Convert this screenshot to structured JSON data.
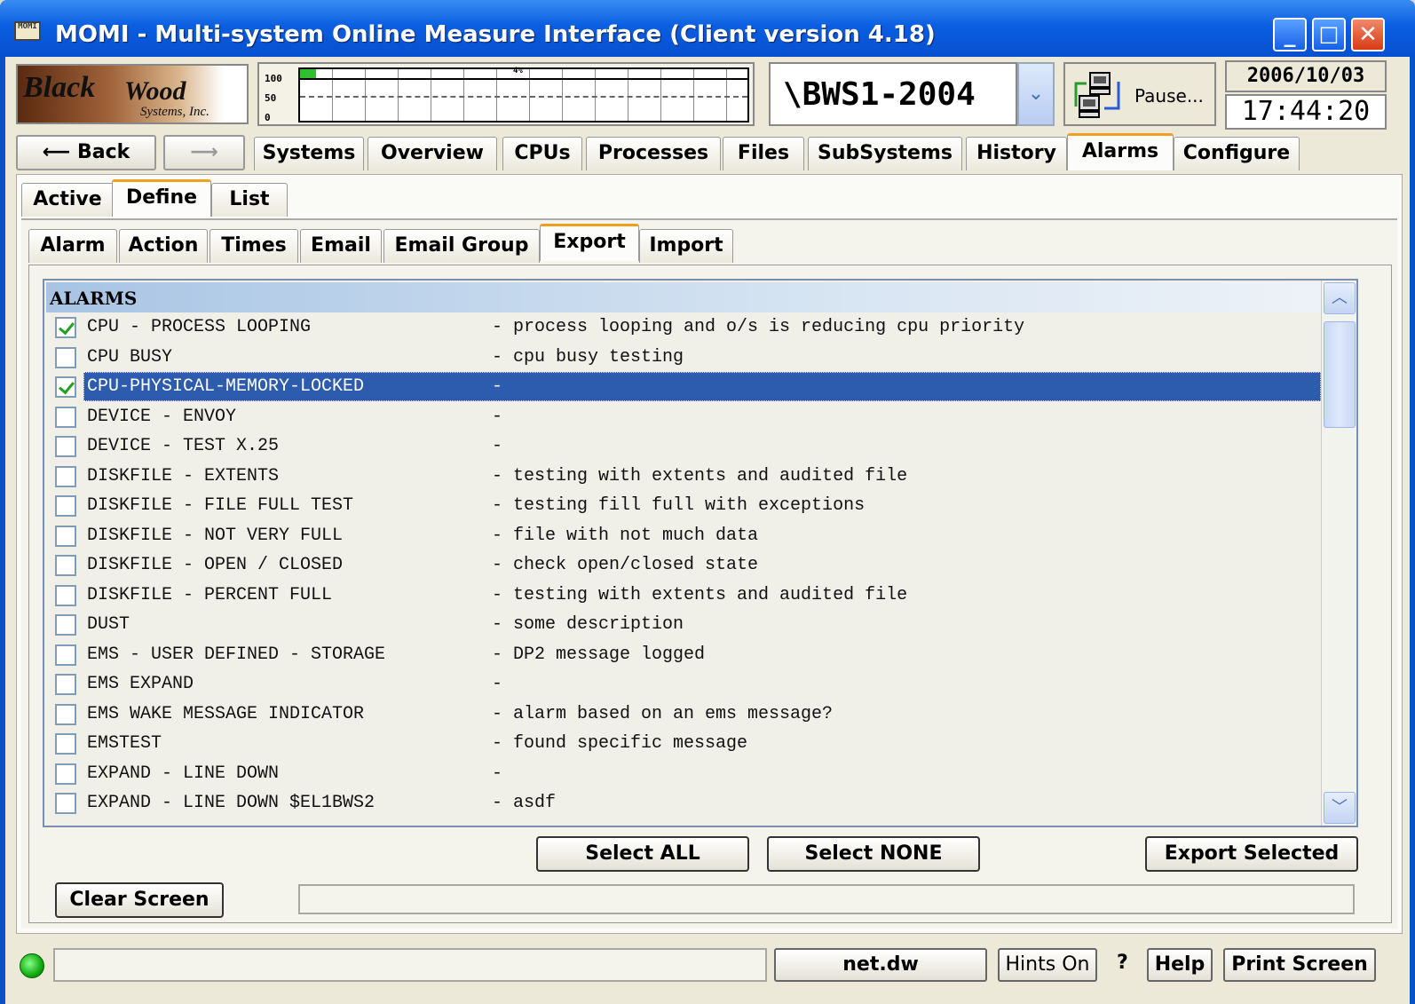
{
  "window": {
    "title": "MOMI - Multi-system Online Measure Interface (Client version 4.18)",
    "icon_text": "MOMI"
  },
  "logo": {
    "line1": "Black",
    "line2": "Wood",
    "line3": "Systems, Inc."
  },
  "cpu_graph": {
    "y_labels": [
      "100",
      "50",
      "0"
    ],
    "pct_label": "4%",
    "bar_color": "#2ec02e"
  },
  "system": {
    "name": "\\BWS1-2004",
    "dropdown_icon": "chevron-down-icon"
  },
  "pause": {
    "label": "Pause..."
  },
  "clock": {
    "date": "2006/10/03",
    "time": "17:44:20"
  },
  "nav": {
    "back": "Back",
    "forward": ""
  },
  "main_tabs": [
    "Systems",
    "Overview",
    "CPUs",
    "Processes",
    "Files",
    "SubSystems",
    "History",
    "Alarms",
    "Configure"
  ],
  "main_tab_selected": "Alarms",
  "sub_tabs": [
    "Active",
    "Define",
    "List"
  ],
  "sub_tab_selected": "Define",
  "define_tabs": [
    "Alarm",
    "Action",
    "Times",
    "Email",
    "Email Group",
    "Export",
    "Import"
  ],
  "define_tab_selected": "Export",
  "alarms_list": {
    "header": "ALARMS",
    "rows": [
      {
        "name": "CPU - PROCESS LOOPING",
        "desc": "- process looping and o/s is reducing cpu priority",
        "checked": true
      },
      {
        "name": "CPU BUSY",
        "desc": "- cpu busy testing",
        "checked": false
      },
      {
        "name": "CPU-PHYSICAL-MEMORY-LOCKED",
        "desc": "-",
        "checked": true,
        "selected": true
      },
      {
        "name": "DEVICE - ENVOY",
        "desc": "-",
        "checked": false
      },
      {
        "name": "DEVICE - TEST X.25",
        "desc": "-",
        "checked": false
      },
      {
        "name": "DISKFILE - EXTENTS",
        "desc": "- testing with extents and audited file",
        "checked": false
      },
      {
        "name": "DISKFILE - FILE FULL TEST",
        "desc": "- testing fill full with exceptions",
        "checked": false
      },
      {
        "name": "DISKFILE - NOT VERY FULL",
        "desc": "- file with not much data",
        "checked": false
      },
      {
        "name": "DISKFILE - OPEN / CLOSED",
        "desc": "- check open/closed state",
        "checked": false
      },
      {
        "name": "DISKFILE - PERCENT FULL",
        "desc": "- testing with extents and audited file",
        "checked": false
      },
      {
        "name": "DUST",
        "desc": "- some description",
        "checked": false
      },
      {
        "name": "EMS - USER DEFINED - STORAGE",
        "desc": "- DP2 message logged",
        "checked": false
      },
      {
        "name": "EMS EXPAND",
        "desc": "-",
        "checked": false
      },
      {
        "name": "EMS WAKE MESSAGE INDICATOR",
        "desc": "- alarm based on an ems message?",
        "checked": false
      },
      {
        "name": "EMSTEST",
        "desc": "- found specific message",
        "checked": false
      },
      {
        "name": "EXPAND - LINE DOWN",
        "desc": "-",
        "checked": false
      },
      {
        "name": "EXPAND - LINE DOWN $EL1BWS2",
        "desc": "- asdf",
        "checked": false
      }
    ]
  },
  "buttons": {
    "select_all": "Select ALL",
    "select_none": "Select NONE",
    "export_selected": "Export Selected",
    "clear_screen": "Clear Screen"
  },
  "statusbar": {
    "server": "net.dw",
    "hints": "Hints On",
    "question": "?",
    "help": "Help",
    "print": "Print Screen",
    "led_color": "#1a1"
  }
}
